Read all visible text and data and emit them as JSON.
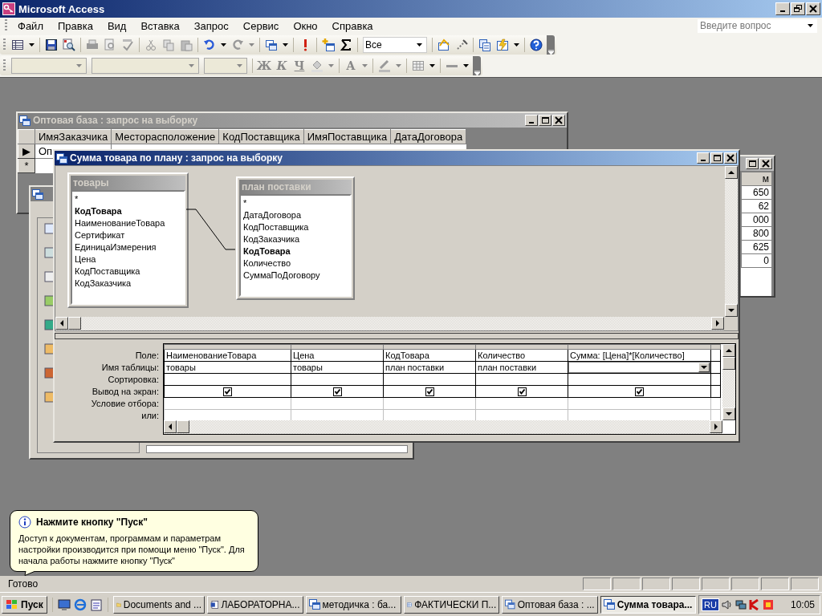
{
  "window": {
    "title": "Microsoft Access"
  },
  "menu": [
    "Файл",
    "Правка",
    "Вид",
    "Вставка",
    "Запрос",
    "Сервис",
    "Окно",
    "Справка"
  ],
  "help_box": {
    "placeholder": "Введите вопрос"
  },
  "toolbar": {
    "top_values_combo": "Все"
  },
  "format_toolbar": {
    "buttons": [
      "Ж",
      "К",
      "Ч",
      "A"
    ]
  },
  "back_query": {
    "title": "Оптовая база : запрос на выборку",
    "columns": [
      "ИмяЗаказчика",
      "Месторасположение",
      "КодПоставщика",
      "ИмяПоставщика",
      "ДатаДоговора"
    ],
    "rows": [
      {
        "selector": "▶",
        "cells": [
          "Оп"
        ]
      },
      {
        "selector": "*"
      }
    ]
  },
  "right_window": {
    "column": "м",
    "values": [
      "650",
      "62",
      "000",
      "800",
      "625",
      "0"
    ]
  },
  "design": {
    "title": "Сумма товара по плану : запрос на выборку",
    "tables": [
      {
        "name": "товары",
        "fields": [
          {
            "name": "*",
            "key": false
          },
          {
            "name": "КодТовара",
            "key": true
          },
          {
            "name": "НаименованиеТовара",
            "key": false
          },
          {
            "name": "Сертификат",
            "key": false
          },
          {
            "name": "ЕдиницаИзмерения",
            "key": false
          },
          {
            "name": "Цена",
            "key": false
          },
          {
            "name": "КодПоставщика",
            "key": false
          },
          {
            "name": "КодЗаказчика",
            "key": false
          }
        ]
      },
      {
        "name": "план поставки",
        "fields": [
          {
            "name": "*",
            "key": false
          },
          {
            "name": "ДатаДоговора",
            "key": false
          },
          {
            "name": "КодПоставщика",
            "key": false
          },
          {
            "name": "КодЗаказчика",
            "key": false
          },
          {
            "name": "КодТовара",
            "key": true
          },
          {
            "name": "Количество",
            "key": false
          },
          {
            "name": "СуммаПоДоговору",
            "key": false
          }
        ]
      }
    ],
    "row_labels": [
      "Поле:",
      "Имя таблицы:",
      "Сортировка:",
      "Вывод на экран:",
      "Условие отбора:",
      "или:"
    ],
    "columns": [
      {
        "kind": "text",
        "field": "НаименованиеТовара",
        "table": "товары",
        "show": true
      },
      {
        "kind": "text",
        "field": "Цена",
        "table": "товары",
        "show": true
      },
      {
        "kind": "text",
        "field": "КодТовара",
        "table": "план поставки",
        "show": true
      },
      {
        "kind": "text",
        "field": "Количество",
        "table": "план поставки",
        "show": true
      },
      {
        "kind": "dropdown",
        "field": "Сумма: [Цена]*[Количество]",
        "show": true
      }
    ]
  },
  "balloon": {
    "title": "Нажмите кнопку \"Пуск\"",
    "text": "Доступ к документам, программам и параметрам настройки производится при помощи меню \"Пуск\". Для начала работы нажмите кнопку \"Пуск\""
  },
  "status_bar": {
    "text": "Готово"
  },
  "taskbar": {
    "start": "Пуск",
    "tasks": [
      {
        "kind": "folder",
        "label": "Documents and ...",
        "selected": false
      },
      {
        "kind": "word",
        "label": "ЛАБОРАТОРНА...",
        "selected": false
      },
      {
        "kind": "window",
        "label": "методичка : ба...",
        "selected": false
      },
      {
        "kind": "table",
        "label": "ФАКТИЧЕСКИ П...",
        "selected": false
      },
      {
        "kind": "window",
        "label": "Оптовая база : ...",
        "selected": false
      },
      {
        "kind": "window",
        "label": "Сумма товара...",
        "selected": true
      }
    ],
    "language": "RU",
    "clock": "10:05"
  }
}
